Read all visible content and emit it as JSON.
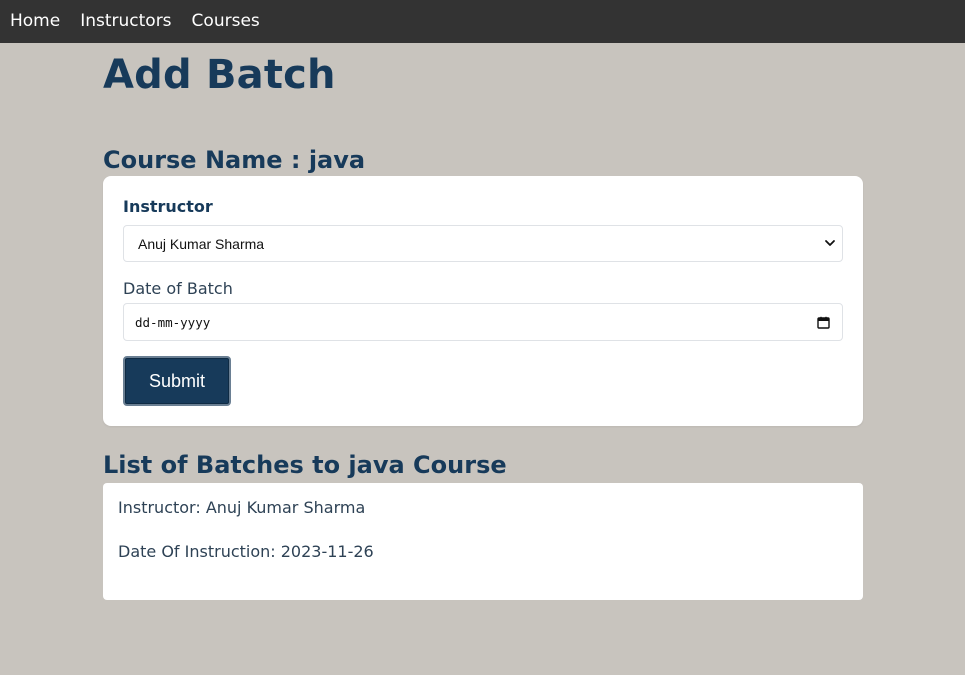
{
  "nav": {
    "items": [
      {
        "label": "Home"
      },
      {
        "label": "Instructors"
      },
      {
        "label": "Courses"
      }
    ]
  },
  "page": {
    "title": "Add Batch",
    "course_heading": "Course Name : java"
  },
  "form": {
    "instructor_label": "Instructor",
    "instructor_selected": "Anuj Kumar Sharma",
    "date_label": "Date of Batch",
    "date_placeholder": "dd-mm-yyyy",
    "submit_label": "Submit"
  },
  "batches": {
    "heading": "List of Batches to java Course",
    "items": [
      {
        "instructor": "Instructor: Anuj Kumar Sharma",
        "date": "Date Of Instruction: 2023-11-26"
      }
    ]
  },
  "colors": {
    "background": "#c8c4be",
    "nav": "#333333",
    "accent": "#173a5a"
  },
  "icons": [
    "chevron-down-icon",
    "calendar-icon"
  ]
}
